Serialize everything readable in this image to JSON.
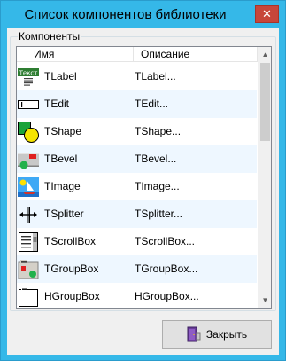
{
  "window": {
    "title": "Список компонентов библиотеки",
    "close_glyph": "✕"
  },
  "group": {
    "label": "Компоненты"
  },
  "list": {
    "columns": [
      "Имя",
      "Описание"
    ],
    "rows": [
      {
        "name": "TLabel",
        "desc": "TLabel...",
        "icon": "label-icon",
        "icon_text": "Текст"
      },
      {
        "name": "TEdit",
        "desc": "TEdit...",
        "icon": "edit-icon"
      },
      {
        "name": "TShape",
        "desc": "TShape...",
        "icon": "shape-icon"
      },
      {
        "name": "TBevel",
        "desc": "TBevel...",
        "icon": "bevel-icon"
      },
      {
        "name": "TImage",
        "desc": "TImage...",
        "icon": "image-icon"
      },
      {
        "name": "TSplitter",
        "desc": "TSplitter...",
        "icon": "splitter-icon"
      },
      {
        "name": "TScrollBox",
        "desc": "TScrollBox...",
        "icon": "scrollbox-icon"
      },
      {
        "name": "TGroupBox",
        "desc": "TGroupBox...",
        "icon": "groupbox-icon"
      },
      {
        "name": "HGroupBox",
        "desc": "HGroupBox...",
        "icon": "hgroupbox-icon"
      }
    ]
  },
  "scrollbar": {
    "up_glyph": "▲",
    "down_glyph": "▼"
  },
  "buttons": {
    "close_label": "Закрыть",
    "close_icon": "exit-door-icon"
  },
  "colors": {
    "titlebar": "#35b8e8",
    "close_button": "#c7463a",
    "row_alt": "#eef7ff"
  }
}
